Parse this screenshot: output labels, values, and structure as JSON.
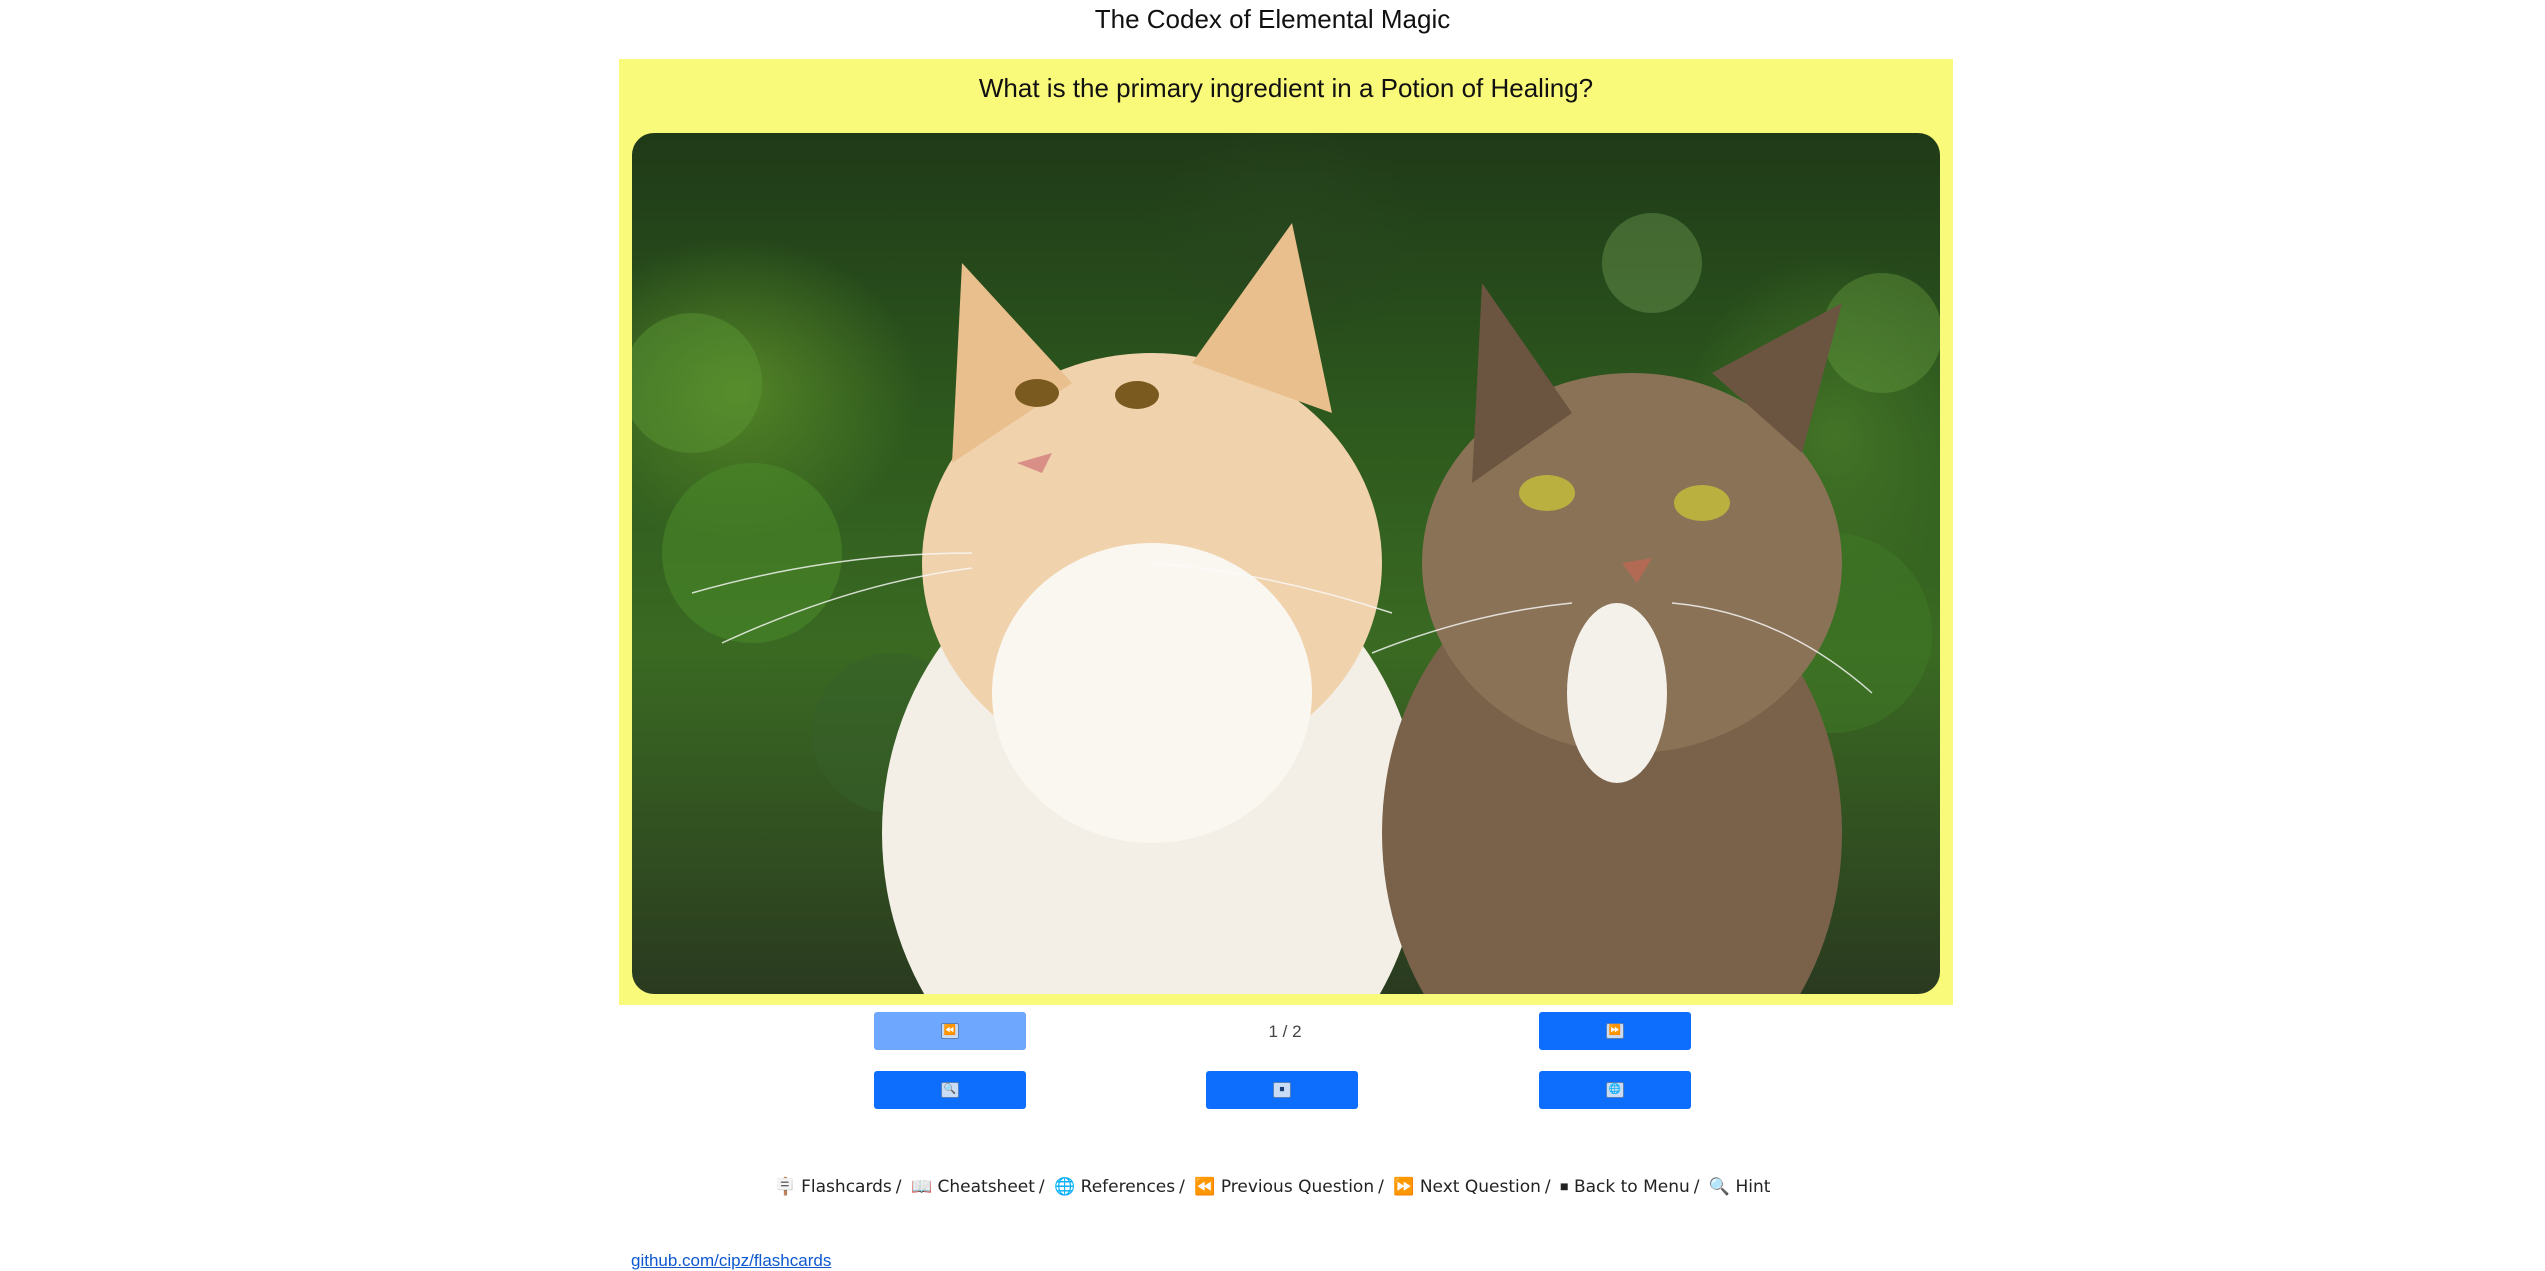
{
  "header": {
    "title": "The Codex of Elemental Magic"
  },
  "card": {
    "question": "What is the primary ingredient in a Potion of Healing?",
    "image": {
      "subject": "two cats: long-haired cream/white cat and brown tabby cat in front of green foliage"
    },
    "background_color": "#f9f97a"
  },
  "navigation": {
    "counter": "1 / 2",
    "buttons": {
      "previous": {
        "glyph": "⏪",
        "icon": "rewind-icon"
      },
      "next": {
        "glyph": "⏩",
        "icon": "fast-forward-icon"
      },
      "hint": {
        "glyph": "🔍",
        "icon": "magnifier-icon"
      },
      "menu": {
        "glyph": "⏹",
        "icon": "stop-icon"
      },
      "references": {
        "glyph": "🌐",
        "icon": "globe-icon"
      }
    },
    "accent_color": "#0d6efd",
    "disabled_color": "#6ea8fe"
  },
  "shortcuts": [
    {
      "icon": "🪧",
      "label": "Flashcards"
    },
    {
      "icon": "📖",
      "label": "Cheatsheet"
    },
    {
      "icon": "🌐",
      "label": "References"
    },
    {
      "icon": "⏪",
      "label": "Previous Question"
    },
    {
      "icon": "⏩",
      "label": "Next Question"
    },
    {
      "icon": "⏹",
      "label": "Back to Menu"
    },
    {
      "icon": "🔍",
      "label": "Hint"
    }
  ],
  "footer": {
    "link_text": "github.com/cipz/flashcards"
  }
}
